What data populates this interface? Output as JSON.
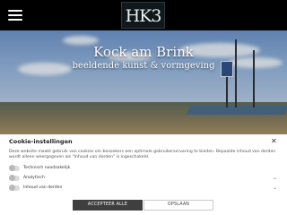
{
  "header": {
    "logo_text": "HK3",
    "menu_icon": "hamburger-icon"
  },
  "hero": {
    "title": "Kock am Brink",
    "subtitle": "beeldende kunst & vormgeving"
  },
  "cookie_banner": {
    "title": "Cookie-instellingen",
    "close_icon": "close-icon",
    "description": "Deze website maakt gebruik van cookies om bezoekers een optimale gebruikerservaring te bieden. Bepaalde inhoud van derden wordt alleen weergegeven als \"Inhoud van derden\" is ingeschakeld.",
    "options": [
      {
        "label": "Technisch noodzakelijk"
      },
      {
        "label": "Analytisch"
      },
      {
        "label": "Inhoud van derden"
      }
    ],
    "accept_label": "ACCEPTEER ALLE",
    "save_label": "OPSLAAN"
  }
}
